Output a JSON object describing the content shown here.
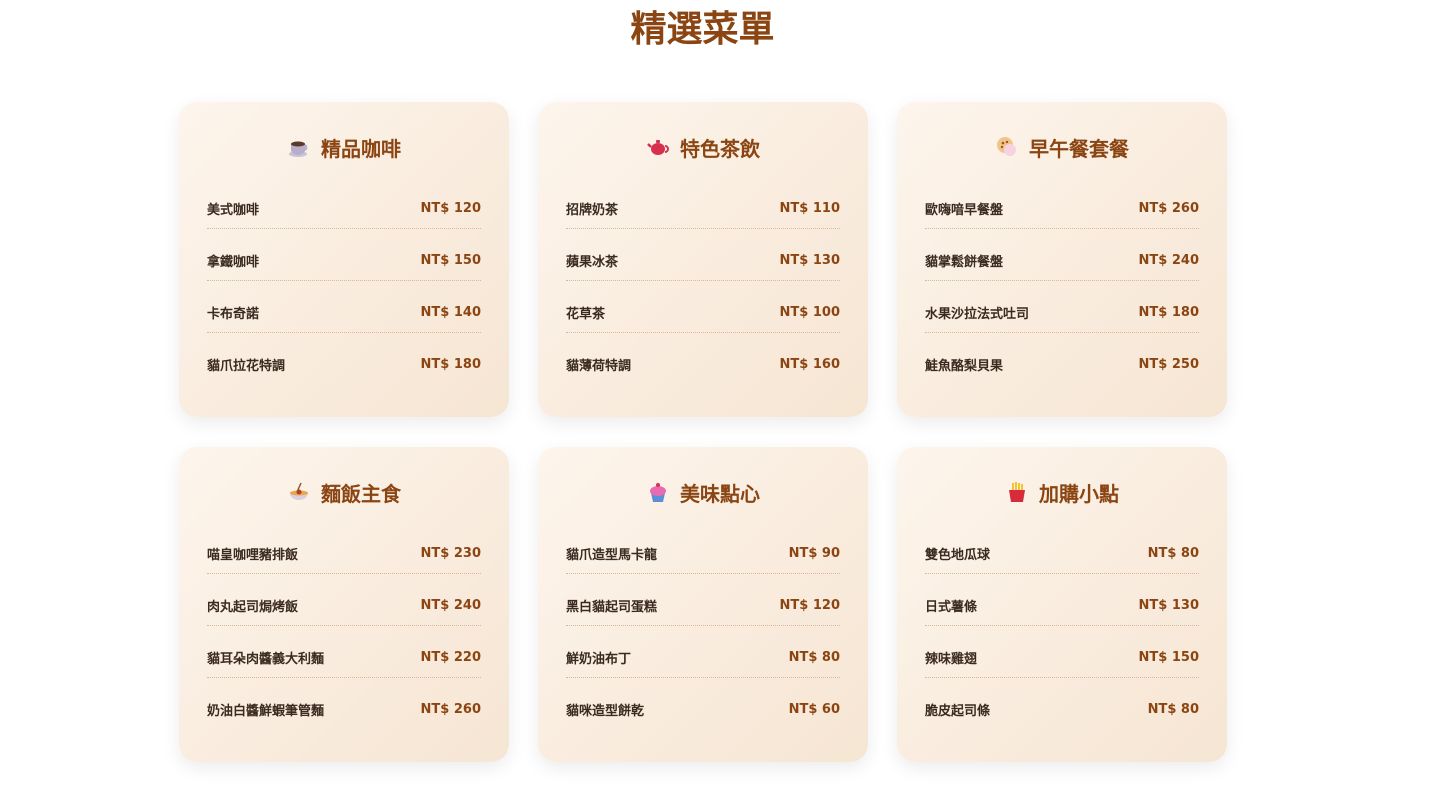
{
  "page_title": "精選菜單",
  "colors": {
    "accent": "#8b4513",
    "card_start": "#fdf5ec",
    "card_end": "#f6e5d3"
  },
  "cards": [
    {
      "title": "精品咖啡",
      "icon": "coffee-cup-icon",
      "items": [
        {
          "name": "美式咖啡",
          "price": "NT$ 120"
        },
        {
          "name": "拿鐵咖啡",
          "price": "NT$ 150"
        },
        {
          "name": "卡布奇諾",
          "price": "NT$ 140"
        },
        {
          "name": "貓爪拉花特調",
          "price": "NT$ 180"
        }
      ]
    },
    {
      "title": "特色茶飲",
      "icon": "teapot-icon",
      "items": [
        {
          "name": "招牌奶茶",
          "price": "NT$ 110"
        },
        {
          "name": "蘋果冰茶",
          "price": "NT$ 130"
        },
        {
          "name": "花草茶",
          "price": "NT$ 100"
        },
        {
          "name": "貓薄荷特調",
          "price": "NT$ 160"
        }
      ]
    },
    {
      "title": "早午餐套餐",
      "icon": "cookie-icon",
      "items": [
        {
          "name": "歐嗨喑早餐盤",
          "price": "NT$ 260"
        },
        {
          "name": "貓掌鬆餅餐盤",
          "price": "NT$ 240"
        },
        {
          "name": "水果沙拉法式吐司",
          "price": "NT$ 180"
        },
        {
          "name": "鮭魚酪梨貝果",
          "price": "NT$ 250"
        }
      ]
    },
    {
      "title": "麵飯主食",
      "icon": "noodle-bowl-icon",
      "items": [
        {
          "name": "喵皇咖哩豬排飯",
          "price": "NT$ 230"
        },
        {
          "name": "肉丸起司焗烤飯",
          "price": "NT$ 240"
        },
        {
          "name": "貓耳朵肉醬義大利麵",
          "price": "NT$ 220"
        },
        {
          "name": "奶油白醬鮮蝦筆管麵",
          "price": "NT$ 260"
        }
      ]
    },
    {
      "title": "美味點心",
      "icon": "cupcake-icon",
      "items": [
        {
          "name": "貓爪造型馬卡龍",
          "price": "NT$ 90"
        },
        {
          "name": "黑白貓起司蛋糕",
          "price": "NT$ 120"
        },
        {
          "name": "鮮奶油布丁",
          "price": "NT$ 80"
        },
        {
          "name": "貓咪造型餅乾",
          "price": "NT$ 60"
        }
      ]
    },
    {
      "title": "加購小點",
      "icon": "fries-icon",
      "items": [
        {
          "name": "雙色地瓜球",
          "price": "NT$ 80"
        },
        {
          "name": "日式薯條",
          "price": "NT$ 130"
        },
        {
          "name": "辣味雞翅",
          "price": "NT$ 150"
        },
        {
          "name": "脆皮起司條",
          "price": "NT$ 80"
        }
      ]
    }
  ]
}
